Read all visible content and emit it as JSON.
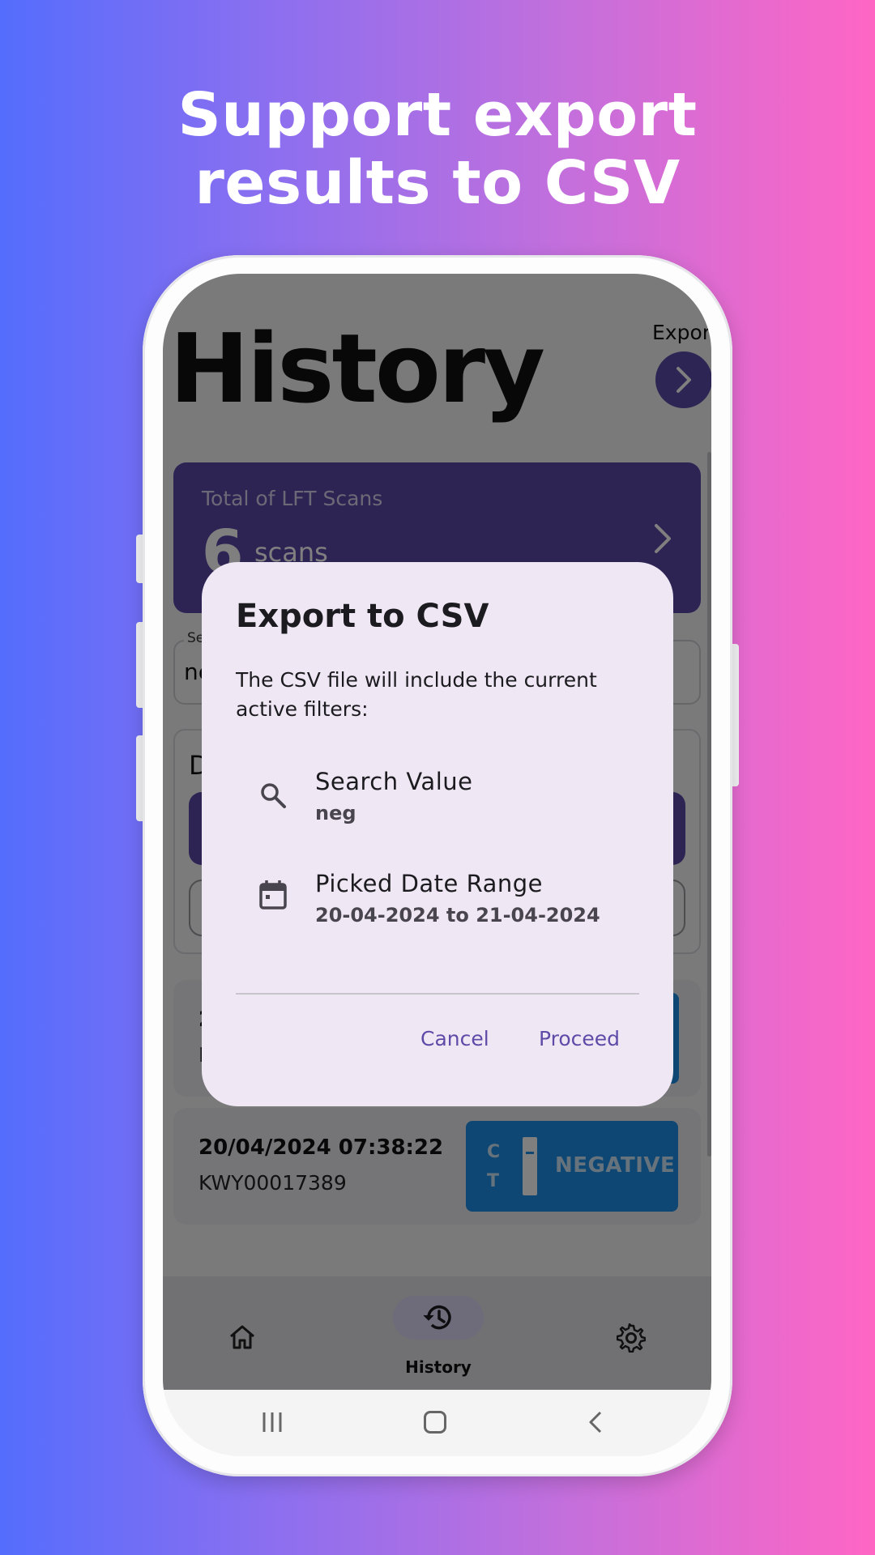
{
  "headline": {
    "line1": "Support export",
    "line2": "results to CSV"
  },
  "app": {
    "title": "History",
    "export_label": "Export",
    "total_card": {
      "label": "Total of LFT Scans",
      "count": "6",
      "unit": "scans"
    },
    "search": {
      "label": "Se",
      "value": "ne"
    },
    "date_card": {
      "title": "D"
    },
    "results": [
      {
        "date": "2",
        "id": "K"
      },
      {
        "date": "20/04/2024 07:38:22",
        "id": "KWY00017389",
        "badge_c": "C",
        "badge_t": "T",
        "result": "NEGATIVE"
      }
    ],
    "nav": {
      "active_label": "History"
    }
  },
  "dialog": {
    "title": "Export to CSV",
    "body": "The CSV file will include the current active filters:",
    "filters": [
      {
        "icon": "search-icon",
        "title": "Search Value",
        "value": "neg"
      },
      {
        "icon": "calendar-icon",
        "title": "Picked Date Range",
        "value": "20-04-2024 to 21-04-2024"
      }
    ],
    "cancel_label": "Cancel",
    "proceed_label": "Proceed"
  },
  "colors": {
    "accent": "#5b48a8",
    "dialog_bg": "#efe8f4",
    "negative_badge": "#1d8fe6",
    "button_text": "#5e4ba8"
  }
}
